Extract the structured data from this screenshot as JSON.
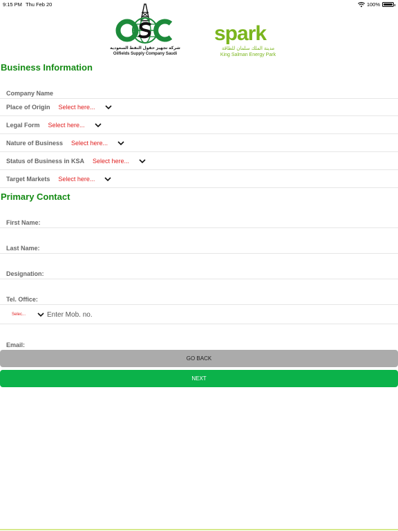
{
  "status_bar": {
    "time": "9:15 PM",
    "date": "Thu Feb 20",
    "battery": "100%",
    "battery_level": 1.0
  },
  "logos": {
    "osc_arabic": "شركة تجهيز حقول النفط السعودية",
    "osc_english": "Oilfields Supply Company Saudi",
    "spark_word": "spark",
    "spark_arabic": "مدينة الملك سلمان للطاقة",
    "spark_english": "King Salman Energy Park"
  },
  "business": {
    "title": "Business Information",
    "company_name_label": "Company Name",
    "fields": [
      {
        "label": "Place of Origin",
        "value": "Select here..."
      },
      {
        "label": "Legal Form",
        "value": "Select here..."
      },
      {
        "label": "Nature of Business",
        "value": "Select here..."
      },
      {
        "label": "Status of Business in KSA",
        "value": "Select here..."
      },
      {
        "label": "Target Markets",
        "value": "Select here..."
      }
    ]
  },
  "contact": {
    "title": "Primary Contact",
    "first_name_label": "First Name:",
    "last_name_label": "Last Name:",
    "designation_label": "Designation:",
    "tel_office_label": "Tel. Office:",
    "mobile_code_placeholder": "Selec...",
    "mobile_placeholder": "Enter Mob. no.",
    "email_label": "Email:"
  },
  "buttons": {
    "back": "GO BACK",
    "next": "NEXT"
  },
  "colors": {
    "heading": "#138a13",
    "select_text": "#e01f1f",
    "next_button": "#0bb24a",
    "back_button": "#ababab",
    "spark_green": "#7ab51d"
  }
}
